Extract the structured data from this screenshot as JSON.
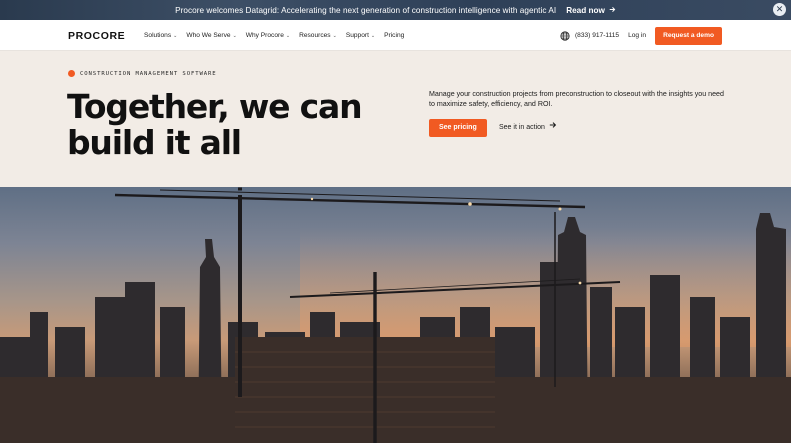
{
  "announcement": {
    "message": "Procore welcomes Datagrid: Accelerating the next generation of construction intelligence with agentic AI",
    "link_label": "Read now",
    "close_label": "✕"
  },
  "nav": {
    "logo": "PROCORE",
    "menu": [
      {
        "label": "Solutions",
        "has_dropdown": true
      },
      {
        "label": "Who We Serve",
        "has_dropdown": true
      },
      {
        "label": "Why Procore",
        "has_dropdown": true
      },
      {
        "label": "Resources",
        "has_dropdown": true
      },
      {
        "label": "Support",
        "has_dropdown": true
      },
      {
        "label": "Pricing",
        "has_dropdown": false
      }
    ],
    "phone": "(833) 917-1115",
    "login_label": "Log in",
    "demo_label": "Request a demo"
  },
  "hero": {
    "eyebrow": "CONSTRUCTION MANAGEMENT SOFTWARE",
    "headline": "Together, we can build it all",
    "description": "Manage your construction projects from preconstruction to closeout with the insights you need to maximize safety, efficiency, and ROI.",
    "primary_cta": "See pricing",
    "secondary_cta": "See it in action"
  },
  "colors": {
    "accent": "#f15a22",
    "hero_bg": "#f2ece6",
    "announcement_bg": "#2a3a4e"
  },
  "icons": {
    "close": "close-icon",
    "arrow": "arrow-right-icon",
    "chevron": "chevron-down-icon",
    "globe": "globe-icon"
  }
}
